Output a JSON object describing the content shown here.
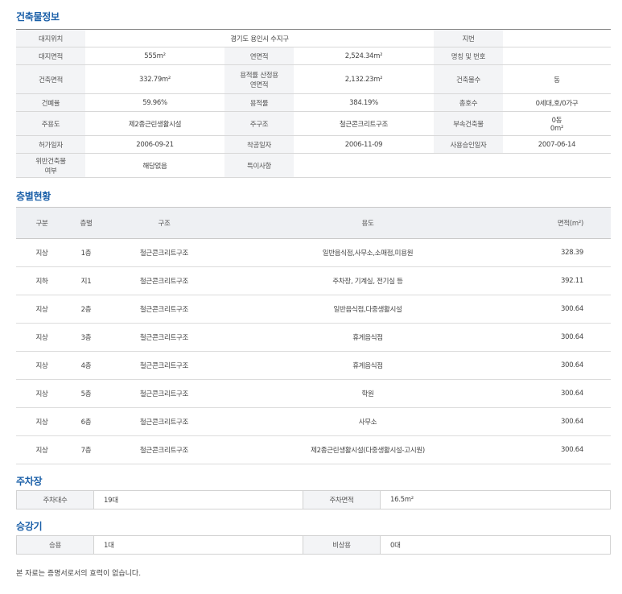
{
  "building_info": {
    "title": "건축물정보",
    "rows": [
      {
        "cells": [
          {
            "label": "대지위치"
          },
          {
            "value": "경기도 용인시 수지구",
            "span": 3
          },
          {
            "label": "지번"
          },
          {
            "value": ""
          }
        ]
      },
      {
        "cells": [
          {
            "label": "대지면적"
          },
          {
            "value": "555m²"
          },
          {
            "label": "연면적"
          },
          {
            "value": "2,524.34m²"
          },
          {
            "label": "명칭 및 번호"
          },
          {
            "value": ""
          }
        ]
      },
      {
        "cells": [
          {
            "label": "건축면적"
          },
          {
            "value": "332.79m²"
          },
          {
            "label": "용적률 산정용\n연면적"
          },
          {
            "value": "2,132.23m²"
          },
          {
            "label": "건축물수"
          },
          {
            "value": "동"
          }
        ]
      },
      {
        "cells": [
          {
            "label": "건폐율"
          },
          {
            "value": "59.96%"
          },
          {
            "label": "용적률"
          },
          {
            "value": "384.19%"
          },
          {
            "label": "총호수"
          },
          {
            "value": "0세대,호/0가구"
          }
        ]
      },
      {
        "cells": [
          {
            "label": "주용도"
          },
          {
            "value": "제2종근린생활시설"
          },
          {
            "label": "주구조"
          },
          {
            "value": "철근콘크리트구조"
          },
          {
            "label": "부속건축물"
          },
          {
            "value": "0동\n0m²"
          }
        ]
      },
      {
        "cells": [
          {
            "label": "허가일자"
          },
          {
            "value": "2006-09-21"
          },
          {
            "label": "착공일자"
          },
          {
            "value": "2006-11-09"
          },
          {
            "label": "사용승인일자"
          },
          {
            "value": "2007-06-14"
          }
        ]
      },
      {
        "cells": [
          {
            "label": "위반건축물\n여부"
          },
          {
            "value": "해당없음"
          },
          {
            "label": "특이사항"
          },
          {
            "value": "",
            "span": 3
          }
        ]
      }
    ]
  },
  "floors": {
    "title": "층별현황",
    "headers": [
      "구분",
      "층별",
      "구조",
      "용도",
      "면적(m²)"
    ],
    "rows": [
      [
        "지상",
        "1층",
        "철근콘크리트구조",
        "일반음식점,사무소,소매점,미용원",
        "328.39"
      ],
      [
        "지하",
        "지1",
        "철근콘크리트구조",
        "주차장, 기계실, 전기실 등",
        "392.11"
      ],
      [
        "지상",
        "2층",
        "철근콘크리트구조",
        "일반음식점,다중생활시설",
        "300.64"
      ],
      [
        "지상",
        "3층",
        "철근콘크리트구조",
        "휴게음식점",
        "300.64"
      ],
      [
        "지상",
        "4층",
        "철근콘크리트구조",
        "휴게음식점",
        "300.64"
      ],
      [
        "지상",
        "5층",
        "철근콘크리트구조",
        "학원",
        "300.64"
      ],
      [
        "지상",
        "6층",
        "철근콘크리트구조",
        "사무소",
        "300.64"
      ],
      [
        "지상",
        "7층",
        "철근콘크리트구조",
        "제2종근린생활시설(다중생활시설-고시원)",
        "300.64"
      ]
    ]
  },
  "parking": {
    "title": "주차장",
    "label1": "주차대수",
    "value1": "19대",
    "label2": "주차면적",
    "value2": "16.5m²"
  },
  "elevator": {
    "title": "승강기",
    "label1": "승용",
    "value1": "1대",
    "label2": "비상용",
    "value2": "0대"
  },
  "footer_note": "본 자료는 증명서로서의 효력이 없습니다."
}
